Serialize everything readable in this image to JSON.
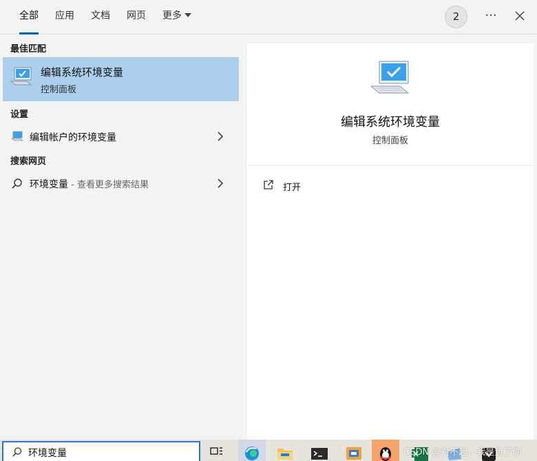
{
  "tabs": [
    {
      "label": "全部"
    },
    {
      "label": "应用"
    },
    {
      "label": "文档"
    },
    {
      "label": "网页"
    },
    {
      "label": "更多"
    }
  ],
  "badge_count": "2",
  "more_actions_glyph": "···",
  "sections": {
    "best_match": "最佳匹配",
    "settings": "设置",
    "search_web": "搜索网页"
  },
  "best_match_item": {
    "title": "编辑系统环境变量",
    "subtitle": "控制面板",
    "icon": "monitor-settings-icon"
  },
  "settings_item": {
    "label": "编辑帐户的环境变量",
    "icon": "monitor-settings-icon"
  },
  "web_item": {
    "query": "环境变量",
    "hint": " - 查看更多搜索结果",
    "icon": "search-icon"
  },
  "detail": {
    "title": "编辑系统环境变量",
    "subtitle": "控制面板",
    "open_label": "打开"
  },
  "search": {
    "value": "环境变量"
  },
  "watermark": "CSDN @对不起，我是负了你",
  "colors": {
    "accent": "#0067c0",
    "selected_row": "#accfee",
    "taskbar": "#e6e2dc"
  }
}
